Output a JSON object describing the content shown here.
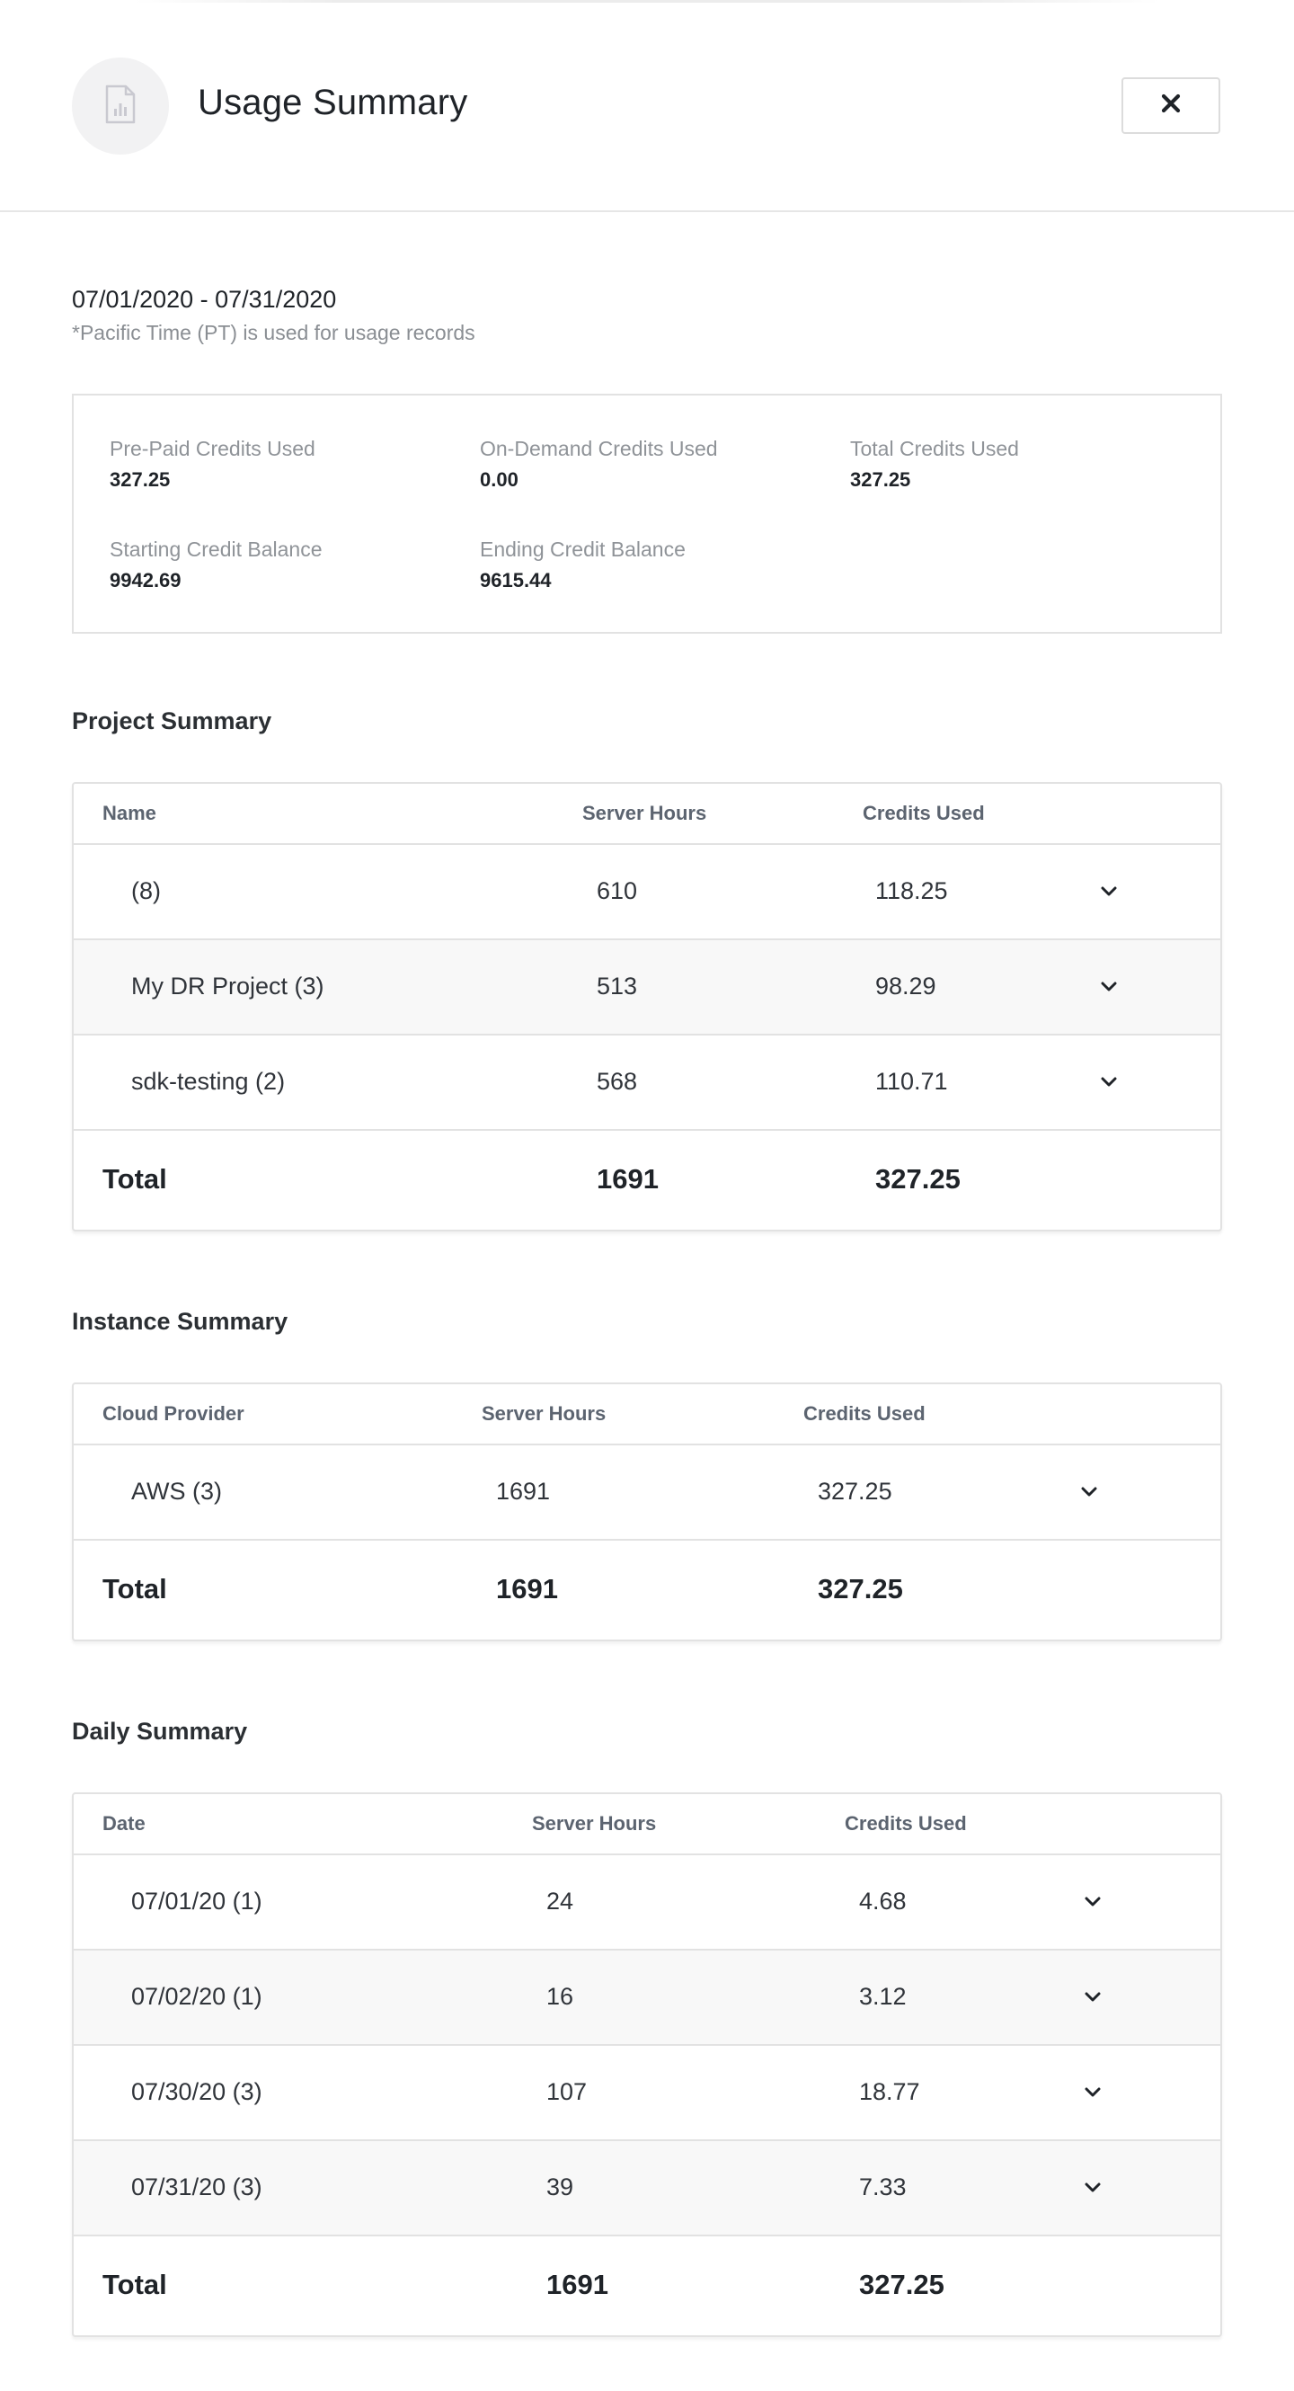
{
  "header": {
    "title": "Usage Summary",
    "report_icon": "bar-chart-document-icon",
    "close_icon": "close-x-icon"
  },
  "period": {
    "range": "07/01/2020 - 07/31/2020",
    "note": "*Pacific Time (PT) is used for usage records"
  },
  "credits": {
    "prepaid_label": "Pre-Paid Credits Used",
    "prepaid_value": "327.25",
    "ondemand_label": "On-Demand Credits Used",
    "ondemand_value": "0.00",
    "total_label": "Total Credits Used",
    "total_value": "327.25",
    "start_label": "Starting Credit Balance",
    "start_value": "9942.69",
    "end_label": "Ending Credit Balance",
    "end_value": "9615.44"
  },
  "project_summary": {
    "title": "Project Summary",
    "headers": {
      "name": "Name",
      "hours": "Server Hours",
      "credits": "Credits Used"
    },
    "rows": [
      {
        "name": "(8)",
        "hours": "610",
        "credits": "118.25"
      },
      {
        "name": "My DR Project (3)",
        "hours": "513",
        "credits": "98.29"
      },
      {
        "name": "sdk-testing (2)",
        "hours": "568",
        "credits": "110.71"
      }
    ],
    "total": {
      "label": "Total",
      "hours": "1691",
      "credits": "327.25"
    }
  },
  "instance_summary": {
    "title": "Instance Summary",
    "headers": {
      "name": "Cloud Provider",
      "hours": "Server Hours",
      "credits": "Credits Used"
    },
    "rows": [
      {
        "name": "AWS (3)",
        "hours": "1691",
        "credits": "327.25"
      }
    ],
    "total": {
      "label": "Total",
      "hours": "1691",
      "credits": "327.25"
    }
  },
  "daily_summary": {
    "title": "Daily Summary",
    "headers": {
      "name": "Date",
      "hours": "Server Hours",
      "credits": "Credits Used"
    },
    "rows": [
      {
        "name": "07/01/20 (1)",
        "hours": "24",
        "credits": "4.68"
      },
      {
        "name": "07/02/20 (1)",
        "hours": "16",
        "credits": "3.12"
      },
      {
        "name": "07/30/20 (3)",
        "hours": "107",
        "credits": "18.77"
      },
      {
        "name": "07/31/20 (3)",
        "hours": "39",
        "credits": "7.33"
      }
    ],
    "total": {
      "label": "Total",
      "hours": "1691",
      "credits": "327.25"
    }
  }
}
